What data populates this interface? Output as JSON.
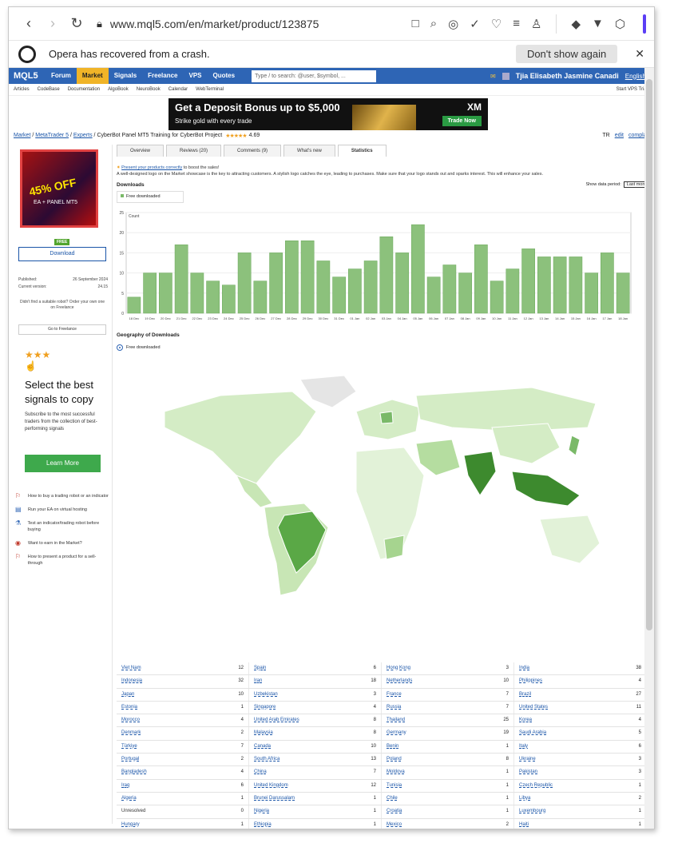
{
  "browser": {
    "url": "www.mql5.com/en/market/product/123875",
    "crash_message": "Opera has recovered from a crash.",
    "dont_show_label": "Don't show again",
    "close_glyph": "✕"
  },
  "mql5_nav": {
    "logo": "MQL5",
    "items": [
      "Forum",
      "Market",
      "Signals",
      "Freelance",
      "VPS",
      "Quotes"
    ],
    "active": "Market",
    "search_placeholder": "Type / to search: @user, $symbol, ...",
    "user_name": "Tjia Elisabeth Jasmine Canadi",
    "language": "English"
  },
  "sub_nav": {
    "items": [
      "Articles",
      "CodeBase",
      "Documentation",
      "AlgoBook",
      "NeuroBook",
      "Calendar",
      "WebTerminal"
    ],
    "vps_trial": "Start VPS Trial"
  },
  "banner": {
    "headline": "Get a Deposit Bonus up to $5,000",
    "sub": "Strike gold with every trade",
    "brand": "XM",
    "cta": "Trade Now"
  },
  "breadcrumb": {
    "items": [
      "Market",
      "MetaTrader 5",
      "Experts"
    ],
    "title": "CyberBot Panel MT5 Training for CyberBot Project",
    "rating": "4.69",
    "tr": "TR",
    "edit": "edit",
    "complain": "complain"
  },
  "product": {
    "image_text_big": "45% OFF",
    "image_text_small": "EA + PANEL MT5",
    "free_badge": "FREE",
    "download_label": "Download",
    "published_label": "Published:",
    "published_value": "26 September 2024",
    "version_label": "Current version:",
    "version_value": "24.15",
    "suitable_text": "Didn't find a suitable robot? Order your own one on Freelance",
    "go_freelance": "Go to Freelance"
  },
  "promo": {
    "title": "Select the best signals to copy",
    "desc": "Subscribe to the most successful traders from the collection of best-performing signals",
    "button": "Learn More"
  },
  "how_list": [
    {
      "text": "How to buy a trading robot or an indicator"
    },
    {
      "text": "Run your EA on virtual hosting"
    },
    {
      "text": "Test an indicator/trading robot before buying"
    },
    {
      "text": "Want to earn in the Market?"
    },
    {
      "text": "How to present a product for a sell-through"
    }
  ],
  "tabs": [
    "Overview",
    "Reviews (20)",
    "Comments (9)",
    "What's new",
    "Statistics"
  ],
  "active_tab": "Statistics",
  "hint": {
    "link": "Present your products correctly",
    "rest": " to boost the sales!",
    "body": "A well-designed logo on the Market showcase is the key to attracting customers. A stylish logo catches the eye, leading to purchases. Make sure that your logo stands out and sparks interest. This will enhance your sales."
  },
  "downloads": {
    "title": "Downloads",
    "period_label": "Show data period:",
    "period_value": "Last month",
    "legend": "Free downloaded"
  },
  "chart_data": {
    "type": "bar",
    "title": "",
    "ylabel": "Count",
    "xlabel": "Date",
    "ylim": [
      0,
      25
    ],
    "yticks": [
      0,
      5,
      10,
      15,
      20,
      25
    ],
    "categories": [
      "18 Dec",
      "19 Dec",
      "20 Dec",
      "21 Dec",
      "22 Dec",
      "23 Dec",
      "24 Dec",
      "25 Dec",
      "26 Dec",
      "27 Dec",
      "28 Dec",
      "29 Dec",
      "30 Dec",
      "31 Dec",
      "01 Jan",
      "02 Jan",
      "03 Jan",
      "04 Jan",
      "05 Jan",
      "06 Jan",
      "07 Jan",
      "08 Jan",
      "09 Jan",
      "10 Jan",
      "11 Jan",
      "12 Jan",
      "13 Jan",
      "14 Jan",
      "15 Jan",
      "16 Jan",
      "17 Jan",
      "18 Jan"
    ],
    "series": [
      {
        "name": "Free downloaded",
        "values": [
          4,
          10,
          10,
          17,
          10,
          8,
          7,
          15,
          8,
          15,
          18,
          18,
          13,
          9,
          11,
          13,
          19,
          15,
          22,
          9,
          12,
          10,
          17,
          8,
          11,
          16,
          14,
          14,
          14,
          10,
          15,
          10
        ]
      }
    ],
    "color": "#8cc17c"
  },
  "geography": {
    "title": "Geography of Downloads",
    "legend": "Free downloaded"
  },
  "countries": [
    [
      [
        "Viet Nam",
        "12"
      ],
      [
        "Spain",
        "6"
      ],
      [
        "Hong Kong",
        "3"
      ],
      [
        "India",
        "38"
      ]
    ],
    [
      [
        "Indonesia",
        "32"
      ],
      [
        "Iran",
        "18"
      ],
      [
        "Netherlands",
        "10"
      ],
      [
        "Philippines",
        "4"
      ]
    ],
    [
      [
        "Japan",
        "10"
      ],
      [
        "Uzbekistan",
        "3"
      ],
      [
        "France",
        "7"
      ],
      [
        "Brazil",
        "27"
      ]
    ],
    [
      [
        "Estonia",
        "1"
      ],
      [
        "Singapore",
        "4"
      ],
      [
        "Russia",
        "7"
      ],
      [
        "United States",
        "11"
      ]
    ],
    [
      [
        "Morocco",
        "4"
      ],
      [
        "United Arab Emirates",
        "8"
      ],
      [
        "Thailand",
        "25"
      ],
      [
        "Korea",
        "4"
      ]
    ],
    [
      [
        "Denmark",
        "2"
      ],
      [
        "Malaysia",
        "8"
      ],
      [
        "Germany",
        "19"
      ],
      [
        "Saudi Arabia",
        "5"
      ]
    ],
    [
      [
        "Türkiye",
        "7"
      ],
      [
        "Canada",
        "10"
      ],
      [
        "Benin",
        "1"
      ],
      [
        "Italy",
        "6"
      ]
    ],
    [
      [
        "Portugal",
        "2"
      ],
      [
        "South Africa",
        "13"
      ],
      [
        "Poland",
        "8"
      ],
      [
        "Ukraine",
        "3"
      ]
    ],
    [
      [
        "Bangladesh",
        "4"
      ],
      [
        "China",
        "7"
      ],
      [
        "Moldova",
        "1"
      ],
      [
        "Pakistan",
        "3"
      ]
    ],
    [
      [
        "Iraq",
        "6"
      ],
      [
        "United Kingdom",
        "12"
      ],
      [
        "Tunisia",
        "1"
      ],
      [
        "Czech Republic",
        "1"
      ]
    ],
    [
      [
        "Algeria",
        "1"
      ],
      [
        "Brunei Darussalam",
        "1"
      ],
      [
        "Chile",
        "1"
      ],
      [
        "Libya",
        "2"
      ]
    ],
    [
      [
        "Unresolved",
        "0"
      ],
      [
        "Nigeria",
        "1"
      ],
      [
        "Croatia",
        "1"
      ],
      [
        "Luxembourg",
        "1"
      ]
    ],
    [
      [
        "Hungary",
        "1"
      ],
      [
        "Ethiopia",
        "1"
      ],
      [
        "Mexico",
        "2"
      ],
      [
        "Haiti",
        "1"
      ]
    ]
  ]
}
